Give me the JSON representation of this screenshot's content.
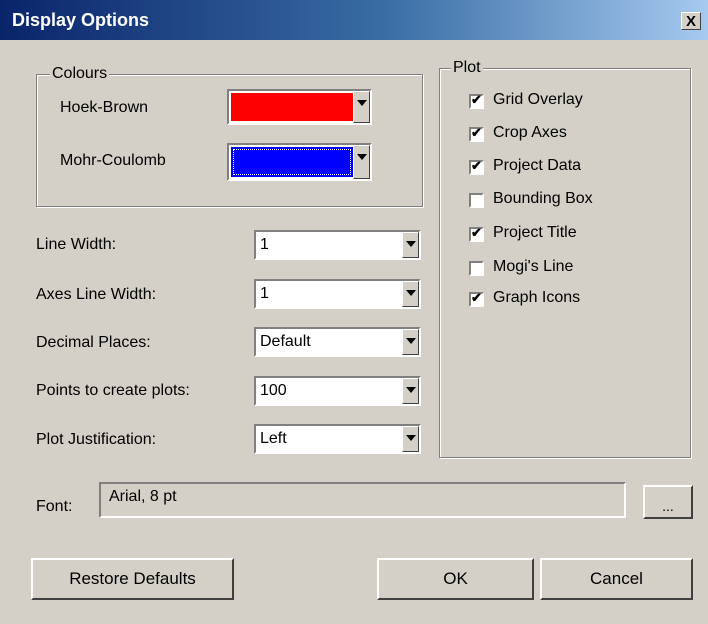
{
  "window": {
    "title": "Display Options",
    "close_label": "X"
  },
  "colours": {
    "legend": "Colours",
    "hoek_brown": {
      "label": "Hoek-Brown",
      "color": "#ff0000"
    },
    "mohr_coulomb": {
      "label": "Mohr-Coulomb",
      "color": "#0000ff"
    }
  },
  "settings": [
    {
      "label": "Line Width:",
      "value": "1"
    },
    {
      "label": "Axes Line Width:",
      "value": "1"
    },
    {
      "label": "Decimal Places:",
      "value": "Default"
    },
    {
      "label": "Points to create plots:",
      "value": "100"
    },
    {
      "label": "Plot Justification:",
      "value": "Left"
    }
  ],
  "plot": {
    "legend": "Plot",
    "options": [
      {
        "label": "Grid Overlay",
        "checked": true
      },
      {
        "label": "Crop Axes",
        "checked": true
      },
      {
        "label": "Project Data",
        "checked": true
      },
      {
        "label": "Bounding Box",
        "checked": false
      },
      {
        "label": "Project Title",
        "checked": true
      },
      {
        "label": "Mogi's Line",
        "checked": false
      },
      {
        "label": "Graph Icons",
        "checked": true
      }
    ]
  },
  "font": {
    "label": "Font:",
    "value": "Arial, 8 pt",
    "browse_label": "..."
  },
  "buttons": {
    "restore": "Restore Defaults",
    "ok": "OK",
    "cancel": "Cancel"
  }
}
